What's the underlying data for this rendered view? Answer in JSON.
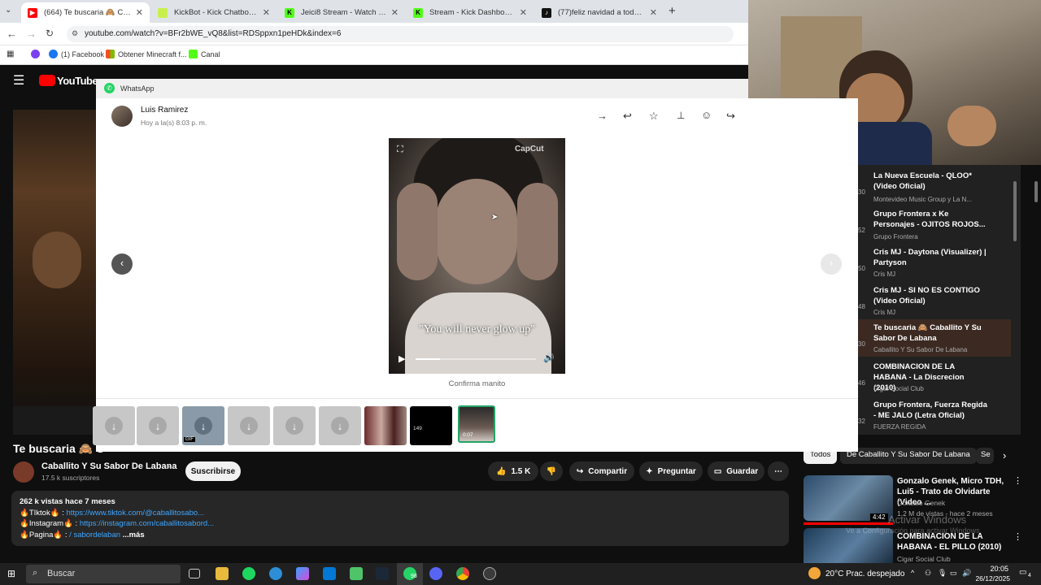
{
  "browser": {
    "tabs": [
      {
        "label": "(664) Te buscaria 🙈 Caballito Y",
        "color": "#ff0000"
      },
      {
        "label": "KickBot - Kick Chatbot, Alerts, T",
        "color": "#c8f04a"
      },
      {
        "label": "Jeici8 Stream - Watch Live on K",
        "color": "#53fc18"
      },
      {
        "label": "Stream - Kick Dashboard",
        "color": "#53fc18"
      },
      {
        "label": "(77)feliz navidad a todos y un p",
        "color": "#111111"
      }
    ],
    "url": "youtube.com/watch?v=BFr2bWE_vQ8&list=RDSppxn1peHDk&index=6",
    "bookmarks": [
      "(1) Facebook",
      "Obtener Minecraft f...",
      "Canal"
    ]
  },
  "youtube": {
    "logo": "YouTube",
    "video_title": "Te buscaria 🙈 C",
    "channel_name": "Caballito Y Su Sabor De Labana",
    "subscribers": "17.5 k suscriptores",
    "subscribe": "Suscribirse",
    "likes": "1.5 K",
    "share": "Compartir",
    "ask": "Preguntar",
    "save": "Guardar",
    "desc_stats": "262 k vistas  hace 7 meses",
    "desc_tiktok_label": "🔥TIktok🔥 :",
    "desc_tiktok": "https://www.tiktok.com/@caballitosabo...",
    "desc_instagram_label": "🔥Instagram🔥 :",
    "desc_instagram": "https://instagram.com/caballitosabord...",
    "desc_pagina_label": "🔥Pagina🔥 :",
    "desc_pagina": "/ sabordelaban",
    "desc_more": "...más",
    "playlist": [
      {
        "num": "30",
        "title": "La Nueva Escuela - QLOO* (Video Oficial)",
        "channel": "Montevideo Music Group y La N..."
      },
      {
        "num": "52",
        "title": "Grupo Frontera x Ke Personajes - OJITOS ROJOS...",
        "channel": "Grupo Frontera"
      },
      {
        "num": "50",
        "title": "Cris MJ - Daytona (Visualizer) | Partyson",
        "channel": "Cris MJ"
      },
      {
        "num": "48",
        "title": "Cris MJ - SI NO ES CONTIGO (Video Oficial)",
        "channel": "Cris MJ"
      },
      {
        "num": "30",
        "title": "Te buscaria 🙈 Caballito Y Su Sabor De Labana",
        "channel": "Caballito Y Su Sabor De Labana"
      },
      {
        "num": "46",
        "title": "COMBINACION DE LA HABANA - La Discrecion (2010)",
        "channel": "Cigar Social Club"
      },
      {
        "num": "32",
        "title": "Grupo Frontera, Fuerza Regida - ME JALO (Letra Oficial)",
        "channel": "FUERZA REGIDA"
      }
    ],
    "chips": [
      "Todos",
      "De Caballito Y Su Sabor De Labana",
      "Se"
    ],
    "recs": [
      {
        "title": "Gonzalo Genek, Micro TDH, Lui5 - Trato de Olvidarte (Video ...",
        "channel": "Gonzalo Genek",
        "meta": "1.2 M de vistas - hace 2 meses",
        "duration": "4:42"
      },
      {
        "title": "COMBINACION DE LA HABANA - EL PILLO (2010)",
        "channel": "Cigar Social Club",
        "meta": "",
        "duration": ""
      }
    ],
    "watermark": "Activar Windows",
    "watermark_sub": "Ve a Configuración para activar Windows."
  },
  "whatsapp": {
    "app_title": "WhatsApp",
    "sender": "Luis Ramirez",
    "time": "Hoy a la(s) 8:03 p. m.",
    "caption": "Confirma  manito",
    "video_subtitle": "\"You will never glow up\"",
    "video_watermark": "CapCut",
    "video_progress": 0.2,
    "thumbs": [
      {
        "type": "download"
      },
      {
        "type": "download"
      },
      {
        "type": "download",
        "badge": "GIF"
      },
      {
        "type": "download"
      },
      {
        "type": "download"
      },
      {
        "type": "download"
      },
      {
        "type": "photo"
      },
      {
        "type": "black",
        "label": "149"
      },
      {
        "type": "video",
        "label": "0:07",
        "selected": true
      }
    ]
  },
  "taskbar": {
    "search": "Buscar",
    "weather": "20°C  Prac. despejado",
    "time": "20:05",
    "date": "26/12/2025",
    "whatsapp_badge": "98",
    "notifications": "4"
  }
}
